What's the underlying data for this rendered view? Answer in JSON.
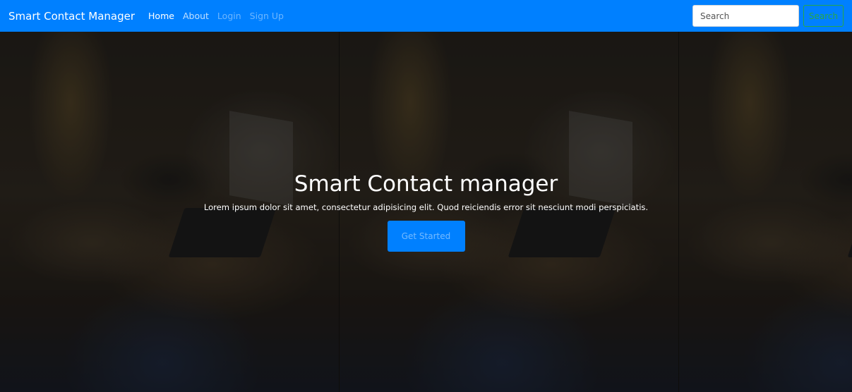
{
  "navbar": {
    "brand": "Smart Contact Manager",
    "links": [
      "Home",
      "About",
      "Login",
      "Sign Up"
    ],
    "search_placeholder": "Search",
    "search_button": "Search"
  },
  "hero": {
    "title": "Smart Contact manager",
    "text": "Lorem ipsum dolor sit amet, consectetur adipisicing elit. Quod reiciendis error sit nesciunt modi perspiciatis.",
    "cta_label": "Get Started"
  },
  "colors": {
    "navbar_bg": "#0080ff",
    "search_button": "#28a745",
    "cta_bg": "#0080ff"
  }
}
